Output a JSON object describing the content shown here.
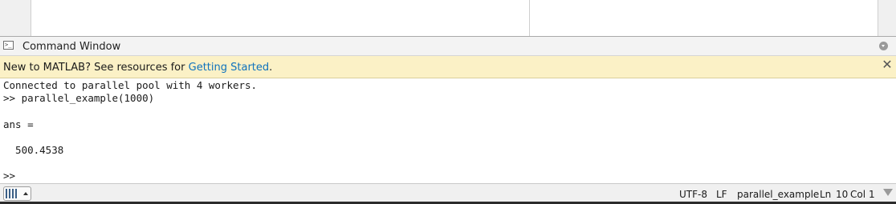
{
  "command_window": {
    "title": "Command Window"
  },
  "banner": {
    "text_prefix": "New to MATLAB? See resources for ",
    "link_label": "Getting Started",
    "text_suffix": ".",
    "close_glyph": "✕"
  },
  "console": {
    "lines": [
      "Connected to parallel pool with 4 workers.",
      ">> parallel_example(1000)",
      "",
      "ans =",
      "",
      "  500.4538",
      "",
      ">>"
    ]
  },
  "status_bar": {
    "encoding": "UTF-8",
    "line_ending": "LF",
    "file": "parallel_example",
    "ln_label": "Ln",
    "ln_value": "10",
    "col_label": "Col",
    "col_value": "1"
  },
  "icons": {
    "command_window": "command-window-icon",
    "panel_menu": "panel-menu-icon",
    "close": "close-icon",
    "layout_toggle": "layout-toggle-icon",
    "resize_grip": "resize-grip-icon"
  }
}
